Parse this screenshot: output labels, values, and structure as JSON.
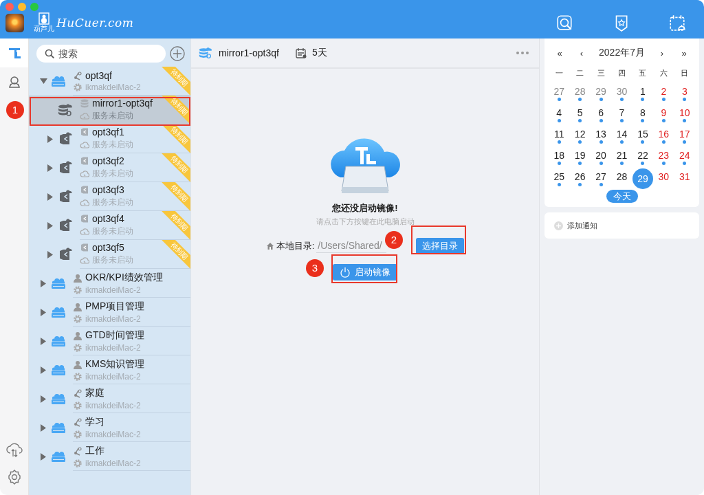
{
  "window": {
    "app_badge": "葫芦儿",
    "logo_text": "HuCuer.com",
    "toolbar": [
      {
        "selected": false
      },
      {
        "selected": false
      },
      {
        "selected": false
      }
    ]
  },
  "rail": {
    "tabs": [
      {
        "selected": true
      },
      {
        "selected": false
      }
    ]
  },
  "tree": {
    "search": {
      "placeholder": "搜索"
    },
    "items": [
      {
        "kind": "drive",
        "badge": {
          "kind": "shared"
        },
        "name": "opt3qf",
        "subtitle": "ikmakdeiMac-2",
        "ribbon": "待到期",
        "expanded": true,
        "selected": false,
        "children": [
          {
            "kind": "mirror",
            "badge": {
              "kind": "db"
            },
            "name": "mirror1-opt3qf",
            "subtitle": "服务未启动",
            "ribbon": "待到期",
            "selected": true
          },
          {
            "kind": "vault",
            "badge": {
              "kind": "vault"
            },
            "name": "opt3qf1",
            "subtitle": "服务未启动",
            "ribbon": "待到期",
            "expanded": false,
            "selected": false
          },
          {
            "kind": "vault",
            "badge": {
              "kind": "vault"
            },
            "name": "opt3qf2",
            "subtitle": "服务未启动",
            "ribbon": "待到期",
            "expanded": false,
            "selected": false
          },
          {
            "kind": "vault",
            "badge": {
              "kind": "vault"
            },
            "name": "opt3qf3",
            "subtitle": "服务未启动",
            "ribbon": "待到期",
            "expanded": false,
            "selected": false
          },
          {
            "kind": "vault",
            "badge": {
              "kind": "vault"
            },
            "name": "opt3qf4",
            "subtitle": "服务未启动",
            "ribbon": "待到期",
            "expanded": false,
            "selected": false
          },
          {
            "kind": "vault",
            "badge": {
              "kind": "vault"
            },
            "name": "opt3qf5",
            "subtitle": "服务未启动",
            "ribbon": "待到期",
            "expanded": false,
            "selected": false
          }
        ]
      },
      {
        "kind": "drive",
        "badge": {
          "kind": "member"
        },
        "name": "OKR/KPI绩效管理",
        "subtitle": "ikmakdeiMac-2",
        "expanded": false,
        "selected": false
      },
      {
        "kind": "drive",
        "badge": {
          "kind": "member"
        },
        "name": "PMP项目管理",
        "subtitle": "ikmakdeiMac-2",
        "expanded": false,
        "selected": false
      },
      {
        "kind": "drive",
        "badge": {
          "kind": "member"
        },
        "name": "GTD时间管理",
        "subtitle": "ikmakdeiMac-2",
        "expanded": false,
        "selected": false
      },
      {
        "kind": "drive",
        "badge": {
          "kind": "member"
        },
        "name": "KMS知识管理",
        "subtitle": "ikmakdeiMac-2",
        "expanded": false,
        "selected": false
      },
      {
        "kind": "drive",
        "badge": {
          "kind": "shared"
        },
        "name": "家庭",
        "subtitle": "ikmakdeiMac-2",
        "expanded": false,
        "selected": false
      },
      {
        "kind": "drive",
        "badge": {
          "kind": "shared"
        },
        "name": "学习",
        "subtitle": "ikmakdeiMac-2",
        "expanded": false,
        "selected": false
      },
      {
        "kind": "drive",
        "badge": {
          "kind": "shared"
        },
        "name": "工作",
        "subtitle": "ikmakdeiMac-2",
        "expanded": false,
        "selected": false
      }
    ]
  },
  "main": {
    "title": "mirror1-opt3qf",
    "days_left": "5天",
    "empty_title": "您还没启动镜像!",
    "empty_hint": "请点击下方按键在此电脑启动",
    "dir_label": "本地目录:",
    "dir_value": "/Users/Shared/",
    "choose_button": "选择目录",
    "start_button": "启动镜像"
  },
  "calendar": {
    "prev_year": "«",
    "prev_month": "‹",
    "month": "2022年7月",
    "next_month": "›",
    "next_year": "»",
    "weekdays": [
      "一",
      "二",
      "三",
      "四",
      "五",
      "六",
      "日"
    ],
    "days": [
      {
        "text": "27",
        "kind": "other",
        "dot": true,
        "selected": false
      },
      {
        "text": "28",
        "kind": "other",
        "dot": true,
        "selected": false
      },
      {
        "text": "29",
        "kind": "other",
        "dot": true,
        "selected": false
      },
      {
        "text": "30",
        "kind": "other",
        "dot": true,
        "selected": false
      },
      {
        "text": "1",
        "kind": "weekday",
        "dot": true,
        "selected": false
      },
      {
        "text": "2",
        "kind": "weekend",
        "dot": true,
        "selected": false
      },
      {
        "text": "3",
        "kind": "weekend",
        "dot": true,
        "selected": false
      },
      {
        "text": "4",
        "kind": "weekday",
        "dot": true,
        "selected": false
      },
      {
        "text": "5",
        "kind": "weekday",
        "dot": true,
        "selected": false
      },
      {
        "text": "6",
        "kind": "weekday",
        "dot": true,
        "selected": false
      },
      {
        "text": "7",
        "kind": "weekday",
        "dot": true,
        "selected": false
      },
      {
        "text": "8",
        "kind": "weekday",
        "dot": true,
        "selected": false
      },
      {
        "text": "9",
        "kind": "weekend",
        "dot": true,
        "selected": false
      },
      {
        "text": "10",
        "kind": "weekend",
        "dot": true,
        "selected": false
      },
      {
        "text": "11",
        "kind": "weekday",
        "dot": true,
        "selected": false
      },
      {
        "text": "12",
        "kind": "weekday",
        "dot": true,
        "selected": false
      },
      {
        "text": "13",
        "kind": "weekday",
        "dot": true,
        "selected": false
      },
      {
        "text": "14",
        "kind": "weekday",
        "dot": true,
        "selected": false
      },
      {
        "text": "15",
        "kind": "weekday",
        "dot": true,
        "selected": false
      },
      {
        "text": "16",
        "kind": "weekend",
        "dot": true,
        "selected": false
      },
      {
        "text": "17",
        "kind": "weekend",
        "dot": true,
        "selected": false
      },
      {
        "text": "18",
        "kind": "weekday",
        "dot": true,
        "selected": false
      },
      {
        "text": "19",
        "kind": "weekday",
        "dot": true,
        "selected": false
      },
      {
        "text": "20",
        "kind": "weekday",
        "dot": true,
        "selected": false
      },
      {
        "text": "21",
        "kind": "weekday",
        "dot": true,
        "selected": false
      },
      {
        "text": "22",
        "kind": "weekday",
        "dot": true,
        "selected": false
      },
      {
        "text": "23",
        "kind": "weekend",
        "dot": true,
        "selected": false
      },
      {
        "text": "24",
        "kind": "weekend",
        "dot": true,
        "selected": false
      },
      {
        "text": "25",
        "kind": "weekday",
        "dot": true,
        "selected": false
      },
      {
        "text": "26",
        "kind": "weekday",
        "dot": true,
        "selected": false
      },
      {
        "text": "27",
        "kind": "weekday",
        "dot": true,
        "selected": false
      },
      {
        "text": "28",
        "kind": "weekday",
        "dot": false,
        "selected": false
      },
      {
        "text": "29",
        "kind": "weekday",
        "dot": false,
        "selected": true
      },
      {
        "text": "30",
        "kind": "weekend",
        "dot": false,
        "selected": false
      },
      {
        "text": "31",
        "kind": "weekend",
        "dot": false,
        "selected": false
      }
    ],
    "today_button": "今天",
    "add_notice": "添加通知"
  },
  "annotations": [
    {
      "label": "1"
    },
    {
      "label": "2"
    },
    {
      "label": "3"
    }
  ]
}
